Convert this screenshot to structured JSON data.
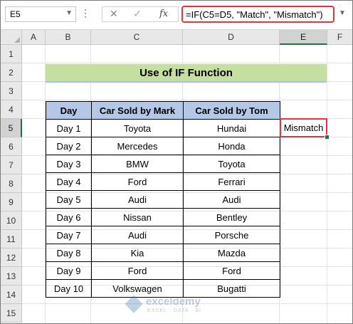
{
  "formula_bar": {
    "name_box": "E5",
    "cancel_icon": "✕",
    "enter_icon": "✓",
    "fx_label": "fx",
    "formula": "=IF(C5=D5, \"Match\", \"Mismatch\")"
  },
  "columns": [
    "A",
    "B",
    "C",
    "D",
    "E",
    "F"
  ],
  "rows": [
    "1",
    "2",
    "3",
    "4",
    "5",
    "6",
    "7",
    "8",
    "9",
    "10",
    "11",
    "12",
    "13",
    "14",
    "15"
  ],
  "title": "Use of IF Function",
  "table": {
    "headers": [
      "Day",
      "Car Sold by Mark",
      "Car Sold by Tom"
    ],
    "rows": [
      [
        "Day 1",
        "Toyota",
        "Hundai"
      ],
      [
        "Day 2",
        "Mercedes",
        "Honda"
      ],
      [
        "Day 3",
        "BMW",
        "Toyota"
      ],
      [
        "Day 4",
        "Ford",
        "Ferrari"
      ],
      [
        "Day 5",
        "Audi",
        "Audi"
      ],
      [
        "Day 6",
        "Nissan",
        "Bentley"
      ],
      [
        "Day 7",
        "Audi",
        "Porsche"
      ],
      [
        "Day 8",
        "Kia",
        "Mazda"
      ],
      [
        "Day 9",
        "Ford",
        "Ford"
      ],
      [
        "Day 10",
        "Volkswagen",
        "Bugatti"
      ]
    ]
  },
  "result_cell": "Mismatch",
  "watermark": {
    "name": "exceldemy",
    "tagline": "EXCEL · DATA · BI"
  },
  "colors": {
    "title_fill": "#c4dfa0",
    "header_fill": "#b4c7e7",
    "highlight_border": "#e0343f",
    "selection_green": "#217346"
  }
}
